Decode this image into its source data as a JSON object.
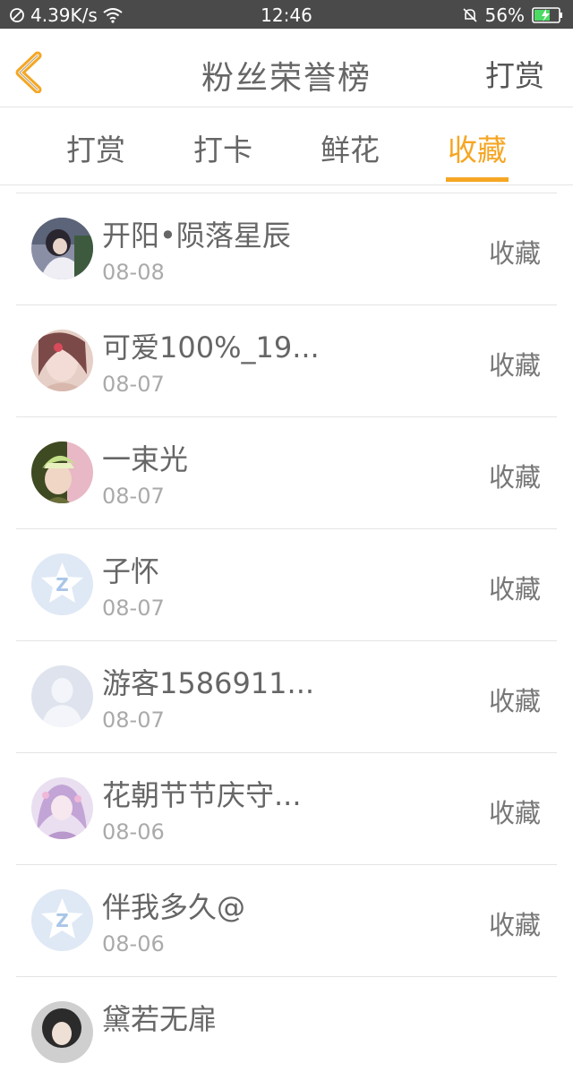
{
  "status_bar": {
    "speed": "4.39K/s",
    "time": "12:46",
    "battery": "56%",
    "icons": [
      "blocked-icon",
      "wifi-icon",
      "bell-off-icon",
      "battery-charging-icon"
    ]
  },
  "nav": {
    "title": "粉丝荣誉榜",
    "action": "打赏",
    "back_icon": "chevron-left-icon",
    "accent": "#f5a623"
  },
  "tabs": [
    {
      "label": "打赏",
      "active": false
    },
    {
      "label": "打卡",
      "active": false
    },
    {
      "label": "鲜花",
      "active": false
    },
    {
      "label": "收藏",
      "active": true
    }
  ],
  "list": [
    {
      "name": "开阳•陨落星辰",
      "date": "08-08",
      "action": "收藏",
      "avatar": "photo-avatar"
    },
    {
      "name": "可爱100%_19...",
      "date": "08-07",
      "action": "收藏",
      "avatar": "photo-avatar"
    },
    {
      "name": "一束光",
      "date": "08-07",
      "action": "收藏",
      "avatar": "photo-avatar"
    },
    {
      "name": "子怀",
      "date": "08-07",
      "action": "收藏",
      "avatar": "qq-default-avatar"
    },
    {
      "name": "游客1586911...",
      "date": "08-07",
      "action": "收藏",
      "avatar": "default-person-avatar"
    },
    {
      "name": "花朝节节庆守...",
      "date": "08-06",
      "action": "收藏",
      "avatar": "photo-avatar"
    },
    {
      "name": "伴我多久@",
      "date": "08-06",
      "action": "收藏",
      "avatar": "qq-default-avatar"
    },
    {
      "name": "黛若无扉",
      "date": "",
      "action": "",
      "avatar": "photo-avatar"
    }
  ]
}
